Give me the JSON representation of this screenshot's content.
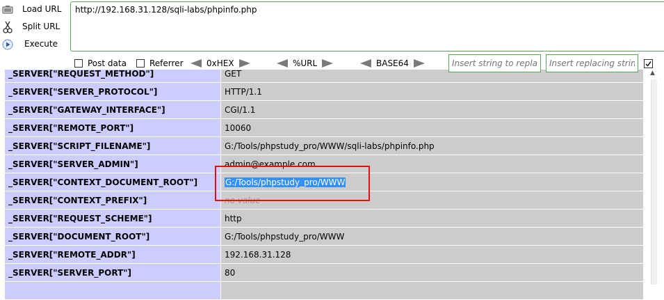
{
  "hackbar": {
    "load_url": "Load URL",
    "split_url": "Split URL",
    "execute": "Execute",
    "url_value": "http://192.168.31.128/sqli-labs/phpinfo.php",
    "post_data": "Post data",
    "referrer": "Referrer",
    "enc_hex": "0xHEX",
    "enc_url": "%URL",
    "enc_base64": "BASE64",
    "replace_from_placeholder": "Insert string to replace",
    "replace_to_placeholder": "Insert replacing string",
    "replace_checkbox_checked": true
  },
  "phpinfo": {
    "rows": [
      {
        "key": "_SERVER[\"REQUEST_METHOD\"]",
        "value": "GET"
      },
      {
        "key": "_SERVER[\"SERVER_PROTOCOL\"]",
        "value": "HTTP/1.1"
      },
      {
        "key": "_SERVER[\"GATEWAY_INTERFACE\"]",
        "value": "CGI/1.1"
      },
      {
        "key": "_SERVER[\"REMOTE_PORT\"]",
        "value": "10060"
      },
      {
        "key": "_SERVER[\"SCRIPT_FILENAME\"]",
        "value": "G:/Tools/phpstudy_pro/WWW/sqli-labs/phpinfo.php"
      },
      {
        "key": "_SERVER[\"SERVER_ADMIN\"]",
        "value": "admin@example.com"
      },
      {
        "key": "_SERVER[\"CONTEXT_DOCUMENT_ROOT\"]",
        "value": "G:/Tools/phpstudy_pro/WWW"
      },
      {
        "key": "_SERVER[\"CONTEXT_PREFIX\"]",
        "value": "no value"
      },
      {
        "key": "_SERVER[\"REQUEST_SCHEME\"]",
        "value": "http"
      },
      {
        "key": "_SERVER[\"DOCUMENT_ROOT\"]",
        "value": "G:/Tools/phpstudy_pro/WWW"
      },
      {
        "key": "_SERVER[\"REMOTE_ADDR\"]",
        "value": "192.168.31.128"
      },
      {
        "key": "_SERVER[\"SERVER_PORT\"]",
        "value": "80"
      },
      {
        "key": "",
        "value": ""
      }
    ]
  }
}
